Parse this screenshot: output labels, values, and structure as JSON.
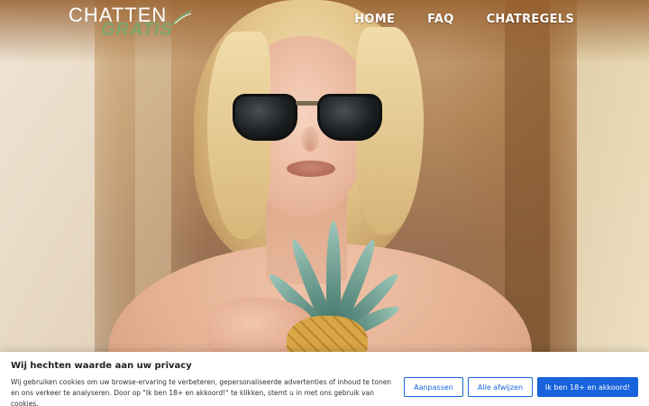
{
  "brand": {
    "logo_top": "CHATTEN",
    "logo_bottom": "GRATIS",
    "logo_accent_color": "#7fa46a"
  },
  "nav": {
    "items": [
      {
        "label": "HOME"
      },
      {
        "label": "FAQ"
      },
      {
        "label": "CHATREGELS"
      }
    ]
  },
  "hero": {
    "image": "blonde-woman-sunglasses-pineapple-photo"
  },
  "cookie_banner": {
    "title": "Wij hechten waarde aan uw privacy",
    "text": "Wij gebruiken cookies om uw browse-ervaring te verbeteren, gepersonaliseerde advertenties of inhoud te tonen en ons verkeer te analyseren. Door op \"Ik ben 18+ en akkoord!\" te klikken, stemt u in met ons gebruik van cookies.",
    "buttons": {
      "customize": "Aanpassen",
      "reject": "Alle afwijzen",
      "accept": "Ik ben 18+ en akkoord!"
    },
    "accent_color": "#1863dc"
  }
}
